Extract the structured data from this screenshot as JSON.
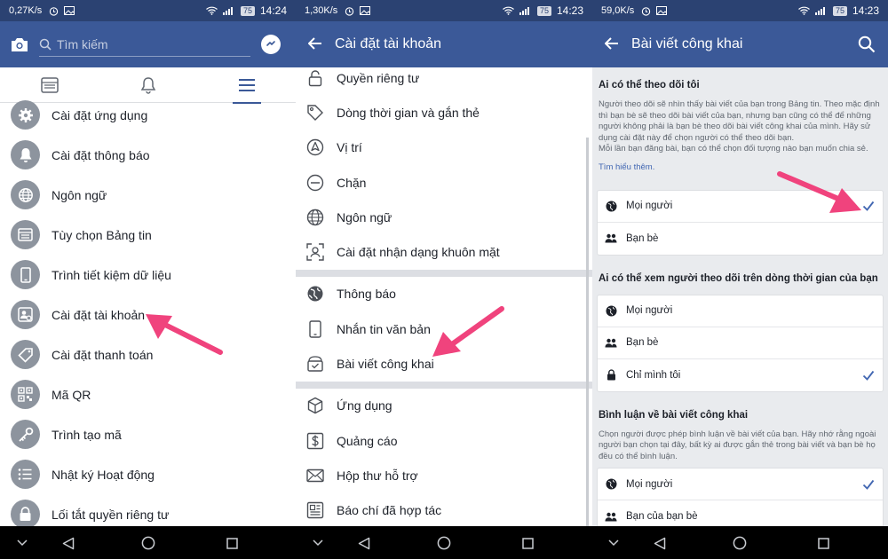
{
  "colors": {
    "fb_blue": "#3b5998",
    "status_bar": "#2b4272",
    "arrow_pink": "#f0437d",
    "check_blue": "#4267b2"
  },
  "panels": [
    {
      "status": {
        "speed": "0,27K/s",
        "battery": "75",
        "time": "14:24"
      },
      "search_placeholder": "Tìm kiếm",
      "tabs": [
        {
          "icon": "news-feed-icon"
        },
        {
          "icon": "bell-icon"
        },
        {
          "icon": "hamburger-menu-icon"
        }
      ],
      "menu": [
        {
          "label": "Cài đặt ứng dụng",
          "icon": "gear-icon"
        },
        {
          "label": "Cài đặt thông báo",
          "icon": "bell-icon"
        },
        {
          "label": "Ngôn ngữ",
          "icon": "globe-icon"
        },
        {
          "label": "Tùy chọn Bảng tin",
          "icon": "feed-icon"
        },
        {
          "label": "Trình tiết kiệm dữ liệu",
          "icon": "phone-icon"
        },
        {
          "label": "Cài đặt tài khoản",
          "icon": "account-icon"
        },
        {
          "label": "Cài đặt thanh toán",
          "icon": "tag-icon"
        },
        {
          "label": "Mã QR",
          "icon": "qr-icon"
        },
        {
          "label": "Trình tạo mã",
          "icon": "key-icon"
        },
        {
          "label": "Nhật ký Hoạt động",
          "icon": "list-icon"
        },
        {
          "label": "Lối tắt quyền riêng tư",
          "icon": "lock-icon"
        }
      ]
    },
    {
      "status": {
        "speed": "1,30K/s",
        "battery": "75",
        "time": "14:23"
      },
      "title": "Cài đặt tài khoản",
      "group1": [
        {
          "label": "Quyền riêng tư",
          "icon": "lock-icon"
        },
        {
          "label": "Dòng thời gian và gắn thẻ",
          "icon": "tag-icon"
        },
        {
          "label": "Vị trí",
          "icon": "location-icon"
        },
        {
          "label": "Chặn",
          "icon": "block-icon"
        },
        {
          "label": "Ngôn ngữ",
          "icon": "globe-icon"
        },
        {
          "label": "Cài đặt nhận dạng khuôn mặt",
          "icon": "face-icon"
        }
      ],
      "group2": [
        {
          "label": "Thông báo",
          "icon": "globe-icon"
        },
        {
          "label": "Nhắn tin văn bản",
          "icon": "phone-icon"
        },
        {
          "label": "Bài viết công khai",
          "icon": "public-post-icon"
        }
      ],
      "group3": [
        {
          "label": "Ứng dụng",
          "icon": "cube-icon"
        },
        {
          "label": "Quảng cáo",
          "icon": "dollar-icon"
        },
        {
          "label": "Hộp thư hỗ trợ",
          "icon": "mail-icon"
        },
        {
          "label": "Báo chí đã hợp tác",
          "icon": "newspaper-icon"
        }
      ]
    },
    {
      "status": {
        "speed": "59,0K/s",
        "battery": "75",
        "time": "14:23"
      },
      "title": "Bài viết công khai",
      "sections": [
        {
          "heading": "Ai có thể theo dõi tôi",
          "description": "Người theo dõi sẽ nhìn thấy bài viết của bạn trong Bảng tin. Theo mặc định thì bạn bè sẽ theo dõi bài viết của bạn, nhưng bạn cũng có thể để những người không phải là bạn bè theo dõi bài viết công khai của mình. Hãy sử dụng cài đặt này để chọn người có thể theo dõi bạn.",
          "description2": "Mỗi lần bạn đăng bài, bạn có thể chọn đối tượng nào bạn muốn chia sẻ.",
          "link": "Tìm hiểu thêm.",
          "options": [
            {
              "label": "Mọi người",
              "icon": "globe-icon",
              "selected": true
            },
            {
              "label": "Bạn bè",
              "icon": "friends-icon",
              "selected": false
            }
          ]
        },
        {
          "heading": "Ai có thể xem người theo dõi trên dòng thời gian của bạn",
          "options": [
            {
              "label": "Mọi người",
              "icon": "globe-icon",
              "selected": false
            },
            {
              "label": "Bạn bè",
              "icon": "friends-icon",
              "selected": false
            },
            {
              "label": "Chỉ mình tôi",
              "icon": "lock-icon",
              "selected": true
            }
          ]
        },
        {
          "heading": "Bình luận về bài viết công khai",
          "description": "Chọn người được phép bình luận về bài viết của bạn. Hãy nhớ rằng ngoài người bạn chọn tại đây, bất kỳ ai được gắn thẻ trong bài viết và bạn bè họ đều có thể bình luận.",
          "options": [
            {
              "label": "Mọi người",
              "icon": "globe-icon",
              "selected": true
            },
            {
              "label": "Bạn của bạn bè",
              "icon": "friends-icon",
              "selected": false
            }
          ]
        }
      ]
    }
  ]
}
